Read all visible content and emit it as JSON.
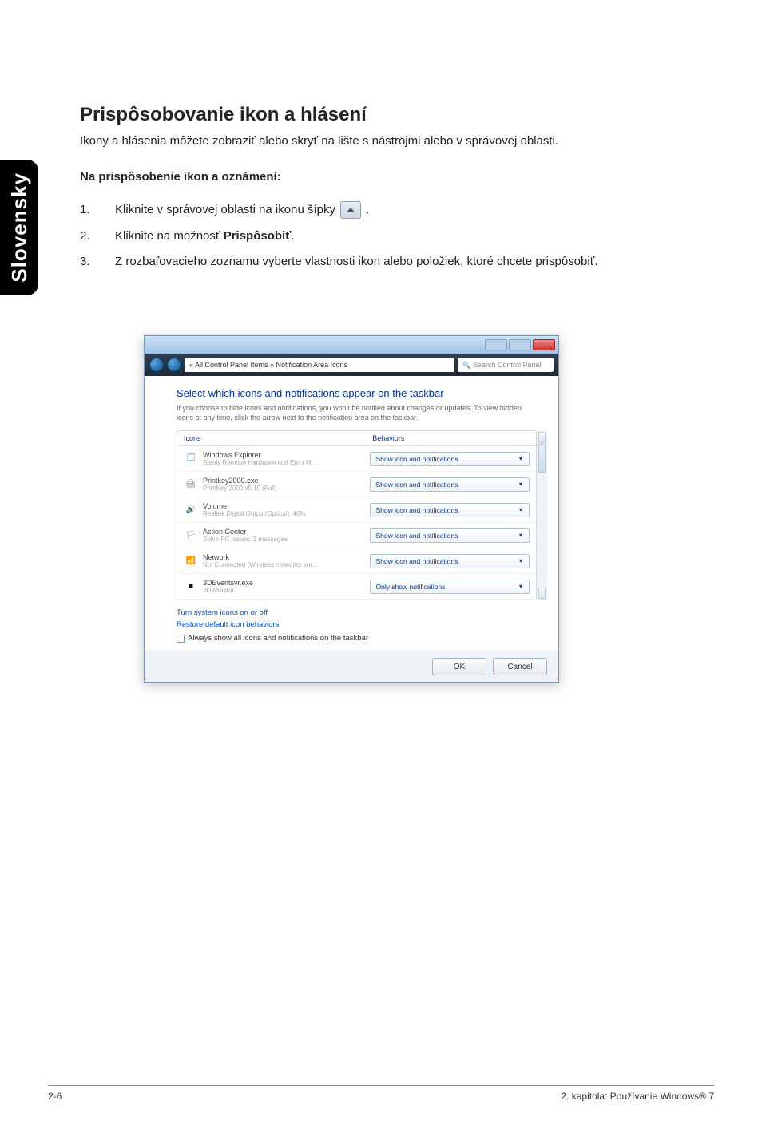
{
  "sideTab": "Slovensky",
  "title": "Prispôsobovanie ikon a hlásení",
  "intro": "Ikony a hlásenia môžete zobraziť alebo skryť na lište s nástrojmi alebo v správovej oblasti.",
  "subhead": "Na prispôsobenie ikon a oznámení:",
  "steps": {
    "s1a": "Kliknite v správovej oblasti na ikonu šípky ",
    "s1b": ".",
    "s2a": "Kliknite na možnosť ",
    "s2bold": "Prispôsobiť",
    "s2b": ".",
    "s3": "Z rozbaľovacieho zoznamu vyberte vlastnosti ikon alebo položiek, ktoré chcete prispôsobiť."
  },
  "dialog": {
    "breadcrumb": "« All Control Panel Items » Notification Area Icons",
    "searchPlaceholder": "Search Control Panel",
    "heading": "Select which icons and notifications appear on the taskbar",
    "desc": "If you choose to hide icons and notifications, you won't be notified about changes or updates. To view hidden icons at any time, click the arrow next to the notification area on the taskbar.",
    "col1": "Icons",
    "col2": "Behaviors",
    "rows": [
      {
        "icon": "🗔",
        "iconColor": "#2a7bd1",
        "name": "Windows Explorer",
        "sub": "Safely Remove Hardware and Eject M...",
        "value": "Show icon and notifications"
      },
      {
        "icon": "🖨",
        "iconColor": "#5a6a7a",
        "name": "Printkey2000.exe",
        "sub": "PrintKey 2000 v5.10 (Full)",
        "value": "Show icon and notifications"
      },
      {
        "icon": "🔊",
        "iconColor": "#888",
        "name": "Volume",
        "sub": "Realtek Digital Output(Optical): 46%",
        "value": "Show icon and notifications"
      },
      {
        "icon": "🏳",
        "iconColor": "#888",
        "name": "Action Center",
        "sub": "Solve PC issues: 3 messages",
        "value": "Show icon and notifications"
      },
      {
        "icon": "📶",
        "iconColor": "#d07a2a",
        "name": "Network",
        "sub": "Not Connected (Wireless networks are...",
        "value": "Show icon and notifications"
      },
      {
        "icon": "■",
        "iconColor": "#111",
        "name": "3DEventsvr.exe",
        "sub": "3D Monitor",
        "value": "Only show notifications"
      }
    ],
    "link1": "Turn system icons on or off",
    "link2": "Restore default icon behaviors",
    "checkbox": "Always show all icons and notifications on the taskbar",
    "ok": "OK",
    "cancel": "Cancel"
  },
  "footer": {
    "left": "2-6",
    "right": "2. kapitola: Používanie Windows® 7"
  }
}
